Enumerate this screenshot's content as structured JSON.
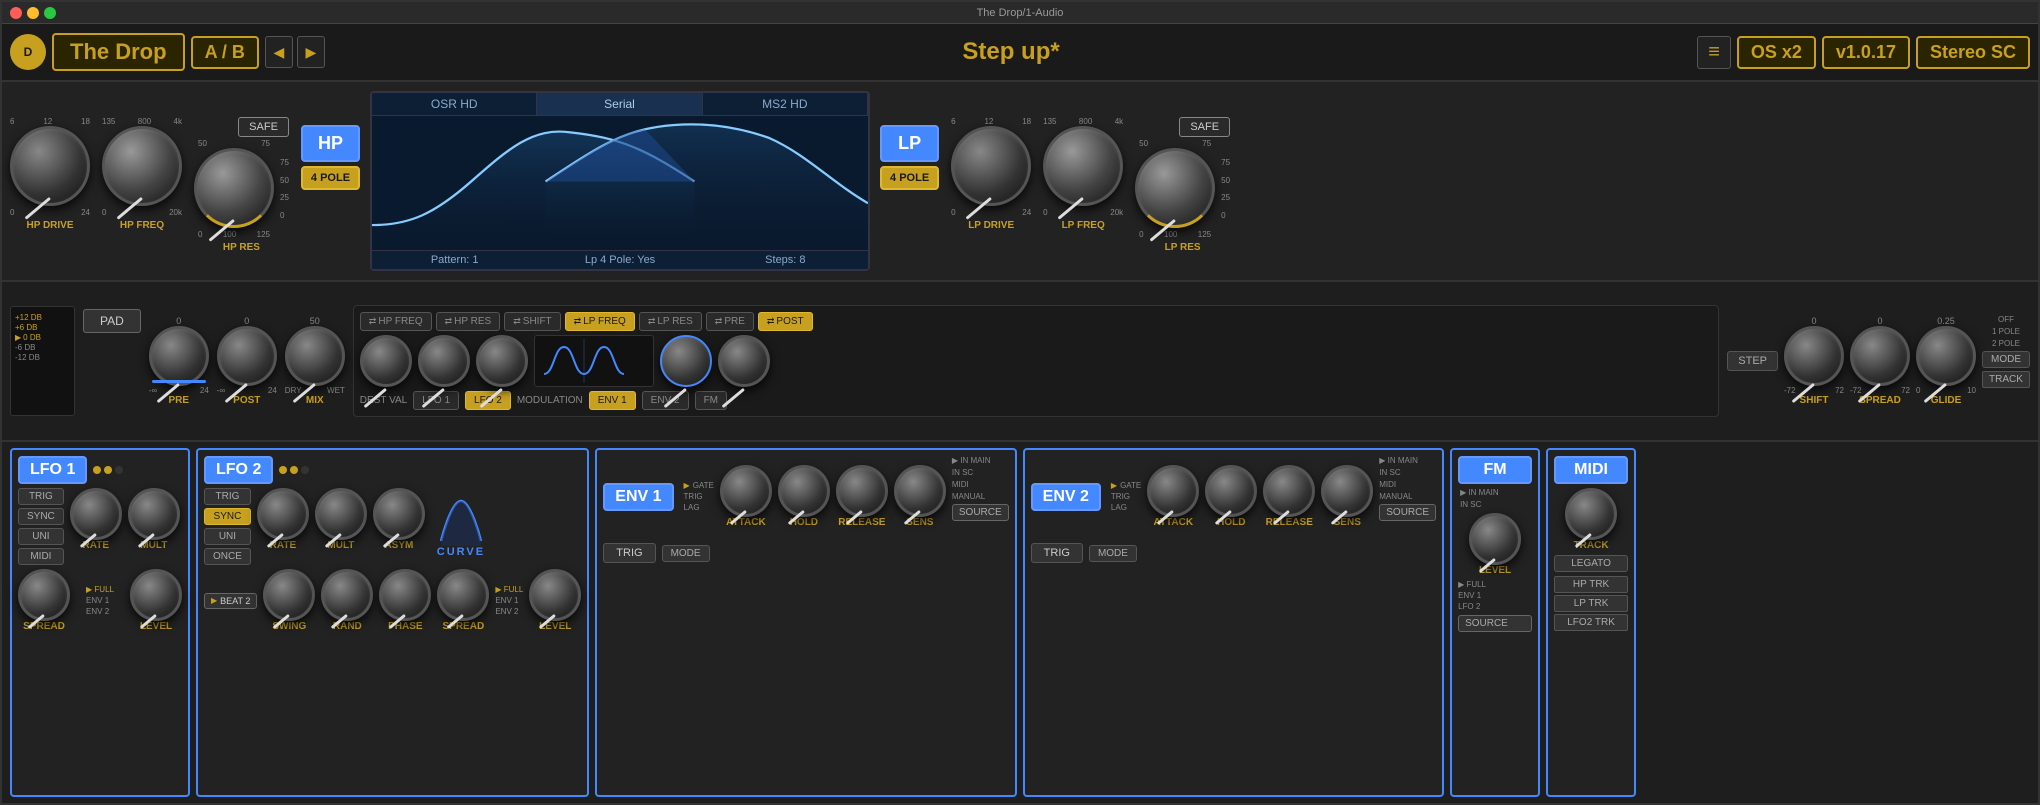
{
  "window": {
    "title": "The Drop/1-Audio"
  },
  "toolbar": {
    "logo": "♫",
    "app_name": "The Drop",
    "ab_label": "A / B",
    "nav_prev": "◀",
    "nav_next": "▶",
    "preset_name": "Step up*",
    "menu_icon": "≡",
    "os_label": "OS x2",
    "version": "v1.0.17",
    "output": "Stereo SC"
  },
  "hp_section": {
    "type_label": "HP",
    "pole_label": "4 POLE",
    "safe_label": "SAFE",
    "drive_label": "HP DRIVE",
    "freq_label": "HP FREQ",
    "res_label": "HP RES",
    "drive_range": [
      "6",
      "12",
      "18",
      "0",
      "24"
    ],
    "freq_range": [
      "135",
      "800",
      "4k",
      "0",
      "20k"
    ],
    "res_range_top": [
      "50",
      "75"
    ],
    "res_range_bottom": [
      "0",
      "100",
      "125"
    ],
    "res_scale": [
      "50",
      "75",
      "100",
      "125"
    ]
  },
  "lp_section": {
    "type_label": "LP",
    "pole_label": "4 POLE",
    "safe_label": "SAFE",
    "drive_label": "LP DRIVE",
    "freq_label": "LP FREQ",
    "res_label": "LP RES",
    "drive_range": [
      "6",
      "12",
      "18",
      "0",
      "24"
    ],
    "freq_range": [
      "135",
      "800",
      "4k",
      "0",
      "20k"
    ],
    "res_range_top": [
      "50",
      "75"
    ],
    "res_range_bottom": [
      "0",
      "100",
      "125"
    ]
  },
  "filter_display": {
    "tabs": [
      "OSR HD",
      "Serial",
      "MS2 HD"
    ],
    "active_tab": "Serial",
    "pattern": "Pattern: 1",
    "lp_4pole": "Lp 4 Pole: Yes",
    "steps": "Steps: 8"
  },
  "pre_post_section": {
    "pre_label": "PRE",
    "post_label": "POST",
    "mix_label": "MIX",
    "pad_label": "PAD",
    "pre_range": [
      "-∞",
      "0",
      "24"
    ],
    "post_range": [
      "-∞",
      "0",
      "24"
    ],
    "mix_range": [
      "DRY",
      "WET"
    ]
  },
  "modulation": {
    "dest_val": "DEST VAL",
    "lfo1_label": "LFO 1",
    "lfo2_label": "LFO 2",
    "modulation_label": "MODULATION",
    "env1_label": "ENV 1",
    "env2_label": "ENV 2",
    "fm_label": "FM",
    "buttons": [
      "HP FREQ",
      "HP RES",
      "SHIFT",
      "LP FREQ",
      "LP RES",
      "PRE",
      "POST"
    ]
  },
  "shift_section": {
    "shift_label": "SHIFT",
    "spread_label": "SPREAD",
    "glide_label": "GLIDE",
    "step_label": "STEP",
    "track_label": "TRACK",
    "mode_label": "MODE",
    "shift_range": [
      "-72",
      "0",
      "72"
    ],
    "spread_range": [
      "-72",
      "0",
      "72"
    ],
    "glide_range": [
      "0",
      "0.25",
      "10"
    ],
    "mode_options": [
      "OFF",
      "1 POLE",
      "2 POLE"
    ]
  },
  "lfo1": {
    "title": "LFO 1",
    "trig_label": "TRIG",
    "sync_label": "SYNC",
    "uni_label": "UNI",
    "midi_label": "MIDI",
    "rate_label": "RATE",
    "mult_label": "MULT",
    "spread_label": "SPREAD",
    "level_label": "LEVEL",
    "level_options": [
      "FULL",
      "ENV 1",
      "ENV 2"
    ]
  },
  "lfo2": {
    "title": "LFO 2",
    "trig_label": "TRIG",
    "sync_label": "SYNC",
    "uni_label": "UNI",
    "once_label": "ONCE",
    "rate_label": "RATE",
    "mult_label": "MULT",
    "swing_label": "SWING",
    "rand_label": "RAND",
    "phase_label": "PHASE",
    "spread_label": "SPREAD",
    "level_label": "LEVEL",
    "asym_label": "ASYM",
    "curve_label": "CURVE",
    "level_options": [
      "FULL",
      "ENV 1",
      "ENV 2"
    ]
  },
  "env1": {
    "title": "ENV 1",
    "trig_label": "TRIG",
    "mode_label": "MODE",
    "attack_label": "ATTACK",
    "hold_label": "HOLD",
    "release_label": "RELEASE",
    "sens_label": "SENS",
    "source_label": "SOURCE",
    "gate_label": "GATE",
    "trig_label2": "TRIG",
    "lag_label": "LAG",
    "source_options": [
      "IN MAIN",
      "IN SC",
      "MIDI",
      "MANUAL"
    ]
  },
  "env2": {
    "title": "ENV 2",
    "trig_label": "TRIG",
    "mode_label": "MODE",
    "attack_label": "ATTACK",
    "hold_label": "HOLD",
    "release_label": "RELEASE",
    "sens_label": "SENS",
    "source_label": "SOURCE",
    "gate_label": "GATE",
    "trig_label2": "TRIG",
    "lag_label": "LAG",
    "source_options": [
      "IN MAIN",
      "IN SC",
      "MIDI",
      "MANUAL"
    ]
  },
  "fm": {
    "title": "FM",
    "level_label": "LEVEL",
    "source_label": "SOURCE",
    "source_options": [
      "FULL",
      "ENV 1",
      "LFO 2"
    ],
    "in_main": "▶ IN MAIN",
    "in_sc": "IN SC"
  },
  "midi": {
    "title": "MIDI",
    "legato_label": "LEGATO",
    "track_label": "TRACK",
    "hp_trk": "HP TRK",
    "lp_trk": "LP TRK",
    "lfo2_trk": "LFO2 TRK"
  },
  "colors": {
    "gold": "#c8a020",
    "blue": "#4488ff",
    "dark_bg": "#1e1e1e",
    "panel_bg": "#222222",
    "text_light": "#cccccc",
    "text_dim": "#888888"
  }
}
